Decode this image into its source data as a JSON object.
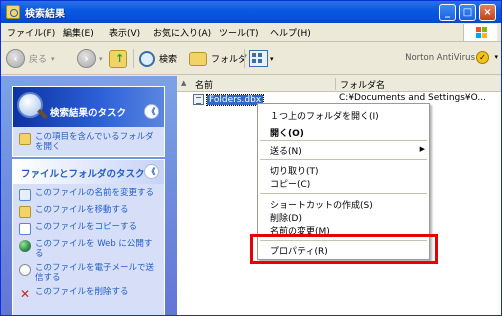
{
  "window": {
    "title": "検索結果",
    "buttons": {
      "minimize": "_",
      "maximize": "□",
      "close": "×"
    }
  },
  "menubar": {
    "items": [
      "ファイル(F)",
      "編集(E)",
      "表示(V)",
      "お気に入り(A)",
      "ツール(T)",
      "ヘルプ(H)"
    ]
  },
  "toolbar": {
    "back_label": "戻る",
    "search_label": "検索",
    "folders_label": "フォルダ",
    "norton_label": "Norton AntiVirus"
  },
  "left_panel": {
    "search_tasks": {
      "title": "検索結果のタスク",
      "toggle": "《",
      "items": [
        "この項目を含んでいるフォルダを開く"
      ]
    },
    "file_tasks": {
      "title": "ファイルとフォルダのタスク",
      "toggle": "《",
      "items": [
        "このファイルの名前を変更する",
        "このファイルを移動する",
        "このファイルをコピーする",
        "このファイルを Web に公開する",
        "このファイルを電子メールで送信する",
        "このファイルを削除する"
      ]
    }
  },
  "list": {
    "columns": {
      "name": "名前",
      "folder": "フォルダ名"
    },
    "rows": [
      {
        "name": "Folders.dbx",
        "folder": "C:¥Documents and Settings¥O..."
      }
    ]
  },
  "context_menu": {
    "items": {
      "open_parent": "１つ上のフォルダを開く(I)",
      "open": "開く(O)",
      "send_to": "送る(N)",
      "cut": "切り取り(T)",
      "copy": "コピー(C)",
      "create_shortcut": "ショートカットの作成(S)",
      "delete": "削除(D)",
      "rename": "名前の変更(M)",
      "properties": "プロパティ(R)"
    }
  },
  "colors": {
    "title_bar": "#0551d8",
    "task_link": "#215dc6",
    "highlight_box": "#e60000",
    "selection": "#316ac5"
  }
}
